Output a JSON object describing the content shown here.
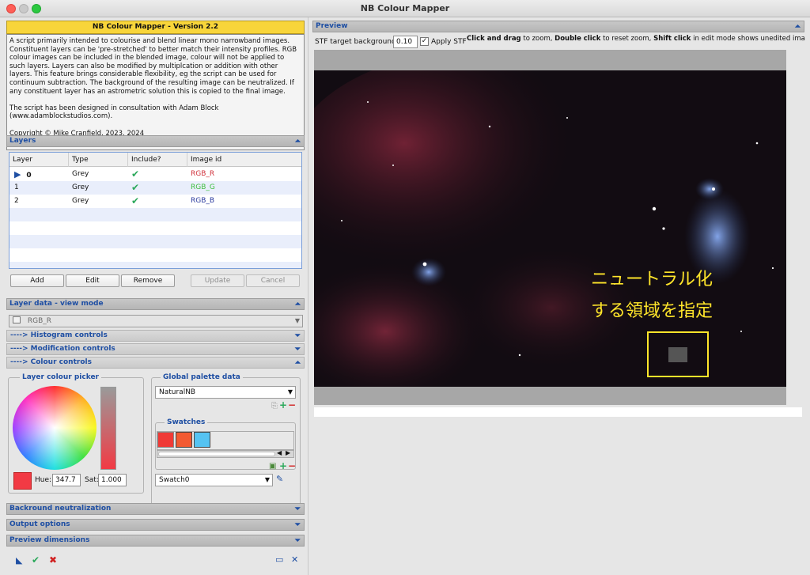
{
  "window": {
    "title": "NB Colour Mapper"
  },
  "left": {
    "banner": "NB Colour Mapper - Version 2.2",
    "info": "A script primarily intended to colourise and blend linear mono narrowband images. Constituent layers can be 'pre-stretched' to better match their intensity profiles. RGB colour images can be included in the blended image, colour will not be applied to such layers. Layers can also be modified by multiplcation or addition with other layers. This feature brings considerable flexibility, eg the script can be used for continuum subtraction. The background of the resulting image can be neutralized. If any constituent layer has an astrometric solution this is copied to the final image.\n\nThe script has been designed in consultation with Adam Block (www.adamblockstudios.com).\n\nCopyright © Mike Cranfield, 2023, 2024",
    "layers_section": "Layers",
    "table": {
      "headers": [
        "Layer",
        "Type",
        "Include?",
        "Image id"
      ],
      "rows": [
        {
          "layer": "0",
          "type": "Grey",
          "include": "✔",
          "image_id": "RGB_R",
          "color": "#d0303a"
        },
        {
          "layer": "1",
          "type": "Grey",
          "include": "✔",
          "image_id": "RGB_G",
          "color": "#3fbf3f"
        },
        {
          "layer": "2",
          "type": "Grey",
          "include": "✔",
          "image_id": "RGB_B",
          "color": "#2a3a9e"
        }
      ]
    },
    "buttons": {
      "add": "Add",
      "edit": "Edit",
      "remove": "Remove",
      "update": "Update",
      "cancel": "Cancel"
    },
    "layer_data_section": "Layer data - view mode",
    "layer_select": "RGB_R",
    "histogram_controls": "----> Histogram controls",
    "modification_controls": "----> Modification controls",
    "colour_controls": "----> Colour controls",
    "picker": {
      "title": "Layer colour picker",
      "hue_label": "Hue:",
      "hue_value": "347.7",
      "sat_label": "Sat:",
      "sat_value": "1.000",
      "colour": "#f23a44"
    },
    "palette": {
      "title": "Global palette data",
      "selected": "NaturalNB",
      "swatches_title": "Swatches",
      "swatch_colors": [
        "#f03a36",
        "#f25a32",
        "#55c3f2"
      ],
      "swatch_select": "Swatch0"
    },
    "background_section": "Backround neutralization",
    "output_section": "Output options",
    "preview_dims_section": "Preview dimensions"
  },
  "right": {
    "preview_section": "Preview",
    "stf_label": "STF target background:",
    "stf_value": "0.10",
    "apply_stf": "Apply STF",
    "hint_bold1": "Click and drag",
    "hint_text1": " to zoom, ",
    "hint_bold2": "Double click",
    "hint_text2": " to reset zoom, ",
    "hint_bold3": "Shift click",
    "hint_text3": " in edit mode shows unedited image.",
    "overlay_line1": "ニュートラル化",
    "overlay_line2": "する領域を指定"
  }
}
